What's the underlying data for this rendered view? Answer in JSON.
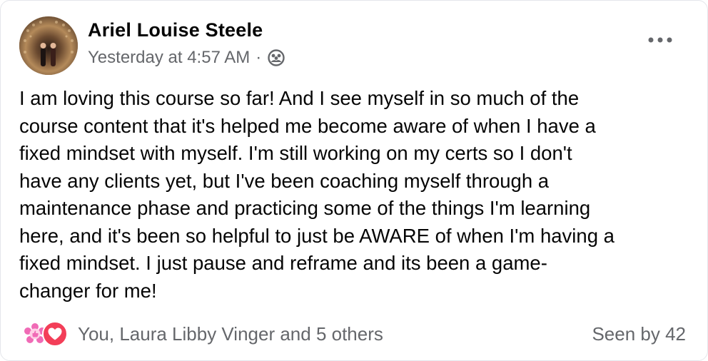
{
  "post": {
    "author": "Ariel Louise Steele",
    "timestamp": "Yesterday at 4:57 AM",
    "separator": "·",
    "audience_icon": "group-icon",
    "more_icon": "more-options-icon",
    "body": "I am loving this course so far! And I see myself in so much of the\ncourse content that it's helped me become aware of when I have a\nfixed mindset with myself. I'm still working on my certs so I don't\nhave any clients yet, but I've been coaching myself through a\nmaintenance phase and practicing some of the things I'm learning\nhere, and it's been so helpful to just be AWARE of when I'm having a\nfixed mindset. I just pause and reframe and its been a game-\nchanger for me!",
    "reactions": {
      "icons": [
        "care-reaction-icon",
        "love-reaction-icon"
      ],
      "summary": "You, Laura Libby Vinger and 5 others"
    },
    "seen_by": "Seen by 42"
  },
  "colors": {
    "text_primary": "#050505",
    "text_secondary": "#65676b",
    "love": "#f33e58",
    "care_flower": "#f06bb6"
  }
}
